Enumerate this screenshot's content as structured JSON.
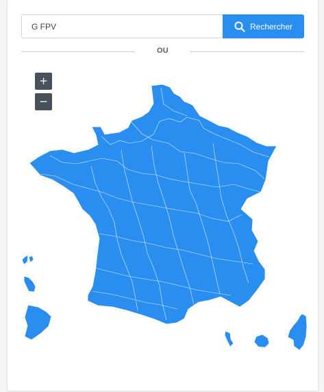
{
  "search": {
    "value": "G FPV",
    "button_label": "Rechercher"
  },
  "divider": {
    "label": "OU"
  },
  "map_controls": {
    "zoom_in": "+",
    "zoom_out": "−"
  },
  "map": {
    "region_color": "#2a8ef0",
    "border_color": "#ffffff",
    "areas": [
      "metropole",
      "corse",
      "guadeloupe",
      "martinique",
      "guyane",
      "reunion",
      "mayotte"
    ]
  },
  "colors": {
    "accent": "#2a8ef0",
    "zoom_button": "#49525c",
    "divider": "#c9ccd1"
  },
  "icons": {
    "search_button": "search-icon"
  }
}
